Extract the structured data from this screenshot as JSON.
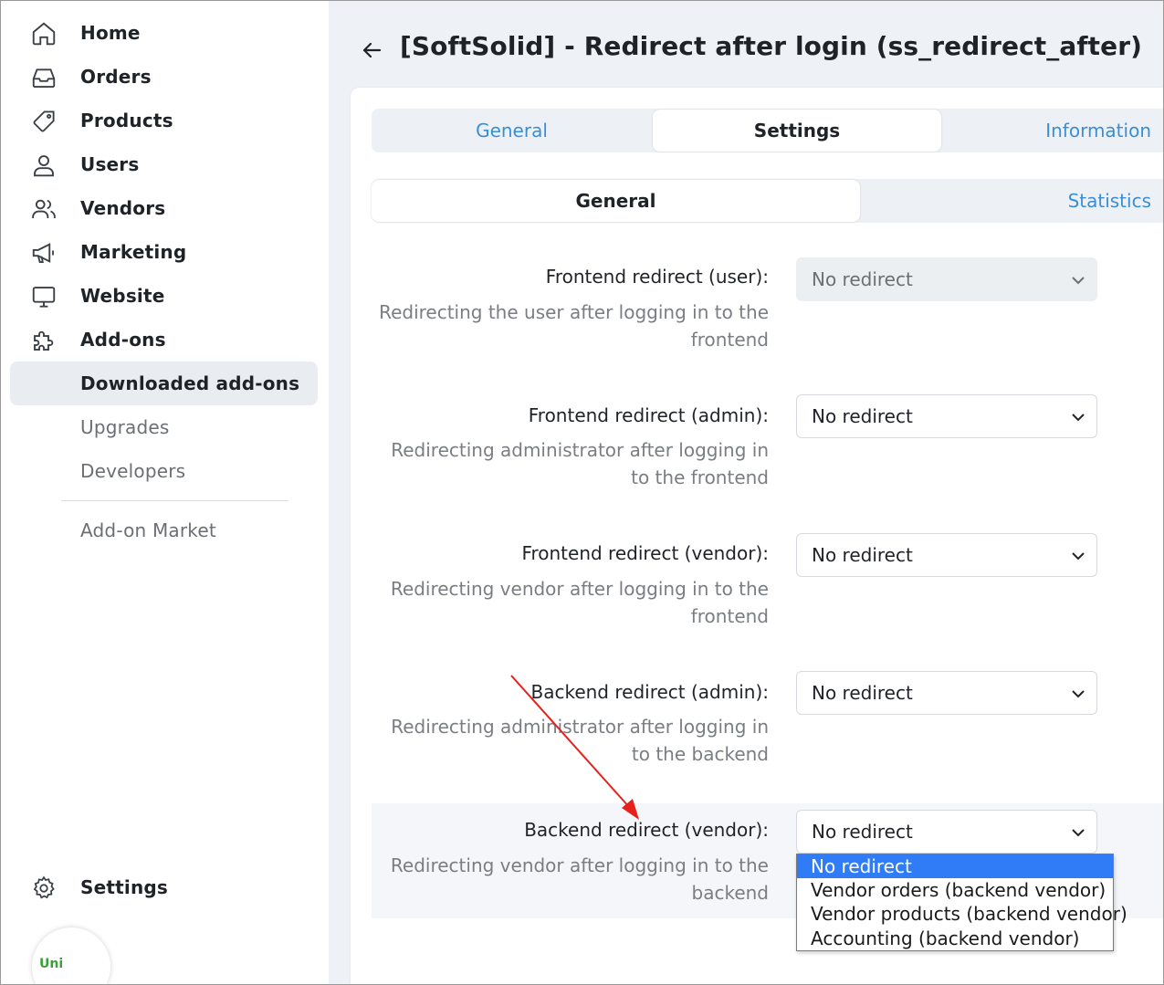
{
  "sidebar": {
    "items": [
      {
        "label": "Home",
        "icon": "home-icon"
      },
      {
        "label": "Orders",
        "icon": "inbox-icon"
      },
      {
        "label": "Products",
        "icon": "tag-icon"
      },
      {
        "label": "Users",
        "icon": "user-icon"
      },
      {
        "label": "Vendors",
        "icon": "users-icon"
      },
      {
        "label": "Marketing",
        "icon": "megaphone-icon"
      },
      {
        "label": "Website",
        "icon": "monitor-icon"
      },
      {
        "label": "Add-ons",
        "icon": "puzzle-icon"
      }
    ],
    "subitems": [
      {
        "label": "Downloaded add-ons",
        "active": true
      },
      {
        "label": "Upgrades"
      },
      {
        "label": "Developers"
      },
      {
        "label": "Add-on Market"
      }
    ],
    "settings": {
      "label": "Settings",
      "icon": "gear-icon"
    },
    "avatar_text": "Uni"
  },
  "header": {
    "title": "[SoftSolid] - Redirect after login (ss_redirect_after)"
  },
  "tabs": [
    {
      "label": "General",
      "active": false
    },
    {
      "label": "Settings",
      "active": true
    },
    {
      "label": "Information",
      "active": false
    }
  ],
  "subtabs": [
    {
      "label": "General",
      "active": true
    },
    {
      "label": "Statistics",
      "active": false
    }
  ],
  "fields": [
    {
      "label": "Frontend redirect (user):",
      "desc": "Redirecting the user after logging in to the frontend",
      "value": "No redirect",
      "disabled": true
    },
    {
      "label": "Frontend redirect (admin):",
      "desc": "Redirecting administrator after logging in to the frontend",
      "value": "No redirect"
    },
    {
      "label": "Frontend redirect (vendor):",
      "desc": "Redirecting vendor after logging in to the frontend",
      "value": "No redirect"
    },
    {
      "label": "Backend redirect (admin):",
      "desc": "Redirecting administrator after logging in to the backend",
      "value": "No redirect"
    },
    {
      "label": "Backend redirect (vendor):",
      "desc": "Redirecting vendor after logging in to the backend",
      "value": "No redirect"
    }
  ],
  "dropdown": {
    "options": [
      "No redirect",
      "Vendor orders (backend vendor)",
      "Vendor products (backend vendor)",
      "Accounting (backend vendor)"
    ],
    "selected_index": 0
  },
  "colors": {
    "accent": "#3a8ed6",
    "selection": "#2f7cf6",
    "annotation_arrow": "#e8201c",
    "avatar_text": "#3aa13a"
  }
}
